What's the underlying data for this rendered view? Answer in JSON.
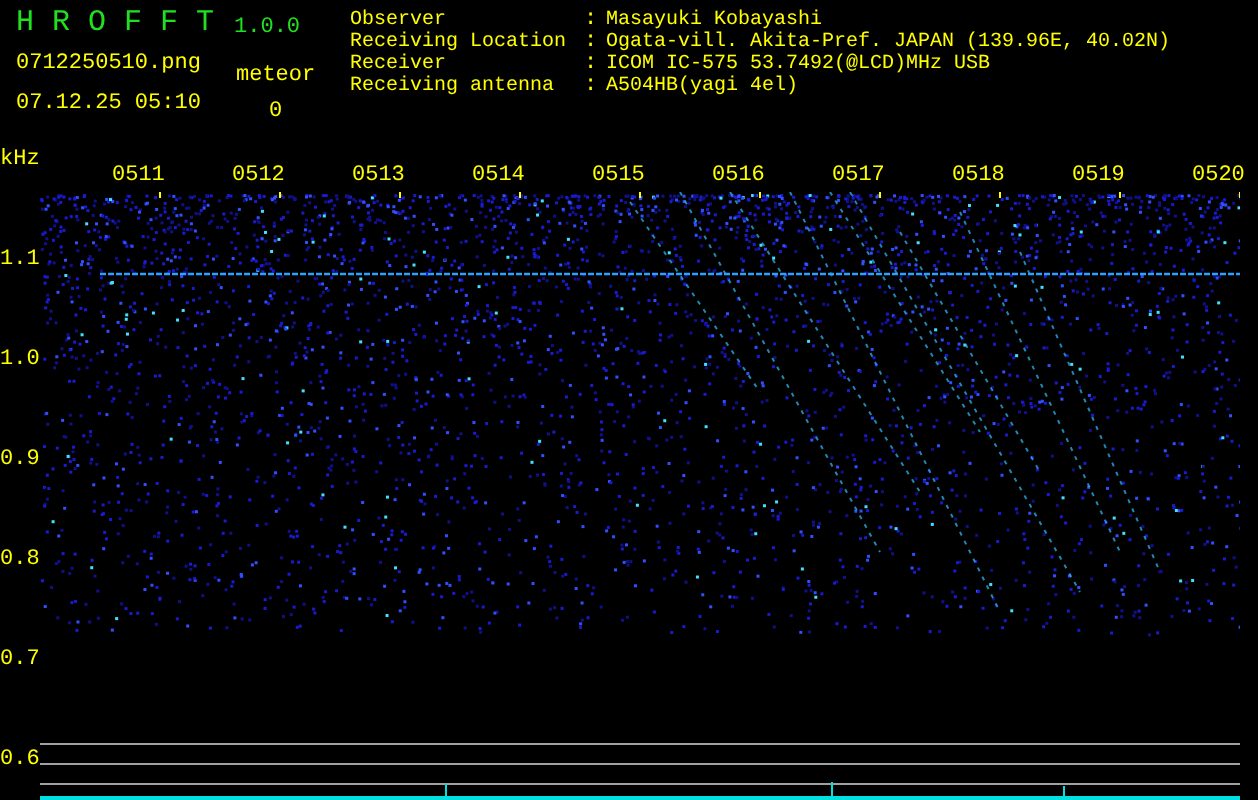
{
  "header": {
    "title": "H R O F F T",
    "version": "1.0.0",
    "file": "0712250510.png",
    "datetime": "07.12.25 05:10",
    "meteor_label": "meteor",
    "meteor_count": "0",
    "info": [
      {
        "label": "Observer",
        "separator": ":",
        "value": "Masayuki Kobayashi"
      },
      {
        "label": "Receiving Location",
        "separator": ":",
        "value": "Ogata-vill. Akita-Pref. JAPAN (139.96E, 40.02N)"
      },
      {
        "label": "Receiver",
        "separator": ":",
        "value": "ICOM IC-575 53.7492(@LCD)MHz USB"
      },
      {
        "label": "Receiving antenna",
        "separator": ":",
        "value": "A504HB(yagi 4el)"
      }
    ]
  },
  "spectrogram": {
    "unit": "kHz",
    "freq_labels": [
      "1.1",
      "1.0",
      "0.9",
      "0.8",
      "0.7",
      "0.6"
    ],
    "time_labels": [
      "0511",
      "0512",
      "0513",
      "0514",
      "0515",
      "0516",
      "0517",
      "0518",
      "0519",
      "0520"
    ]
  }
}
